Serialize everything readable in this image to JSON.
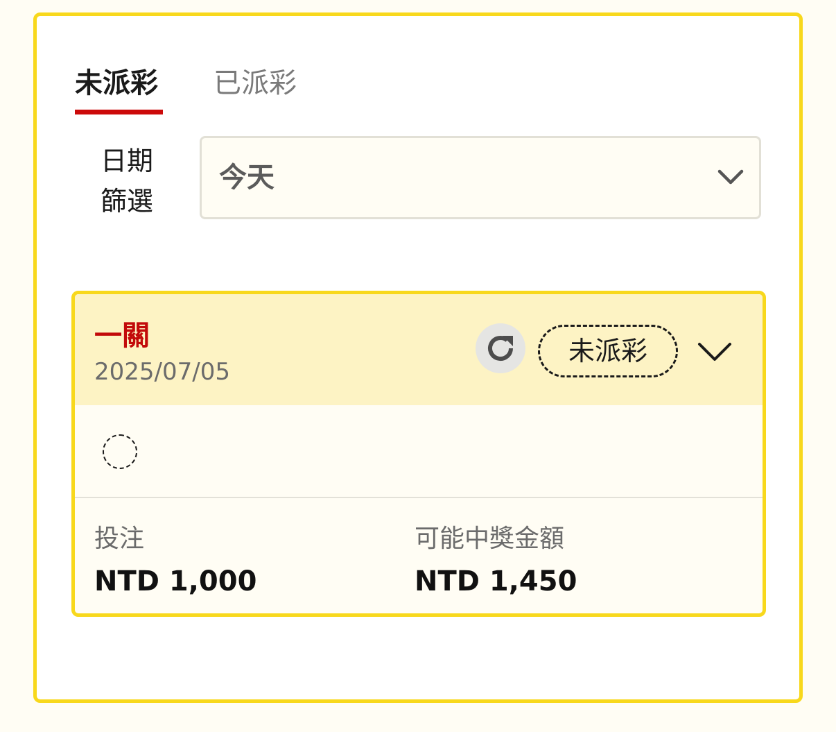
{
  "tabs": {
    "active_label": "未派彩",
    "inactive_label": "已派彩"
  },
  "date_filter": {
    "label_line1": "日期",
    "label_line2": "篩選",
    "selected_value": "今天"
  },
  "bet_card": {
    "bet_type": "一關",
    "date": "2025/07/05",
    "status": "未派彩",
    "stake_label": "投注",
    "stake_value": "NTD 1,000",
    "potential_payout_label": "可能中獎金額",
    "potential_payout_value": "NTD 1,450"
  },
  "colors": {
    "accent_yellow": "#f8d81c",
    "active_tab_underline": "#cc0a0a",
    "bet_type_red": "#c20a0a",
    "card_header_bg": "#fdf3c4"
  },
  "icons": {
    "dropdown": "chevron-down-icon",
    "refresh": "refresh-icon",
    "expand": "chevron-down-icon",
    "selection_placeholder": "dashed-circle-icon"
  }
}
